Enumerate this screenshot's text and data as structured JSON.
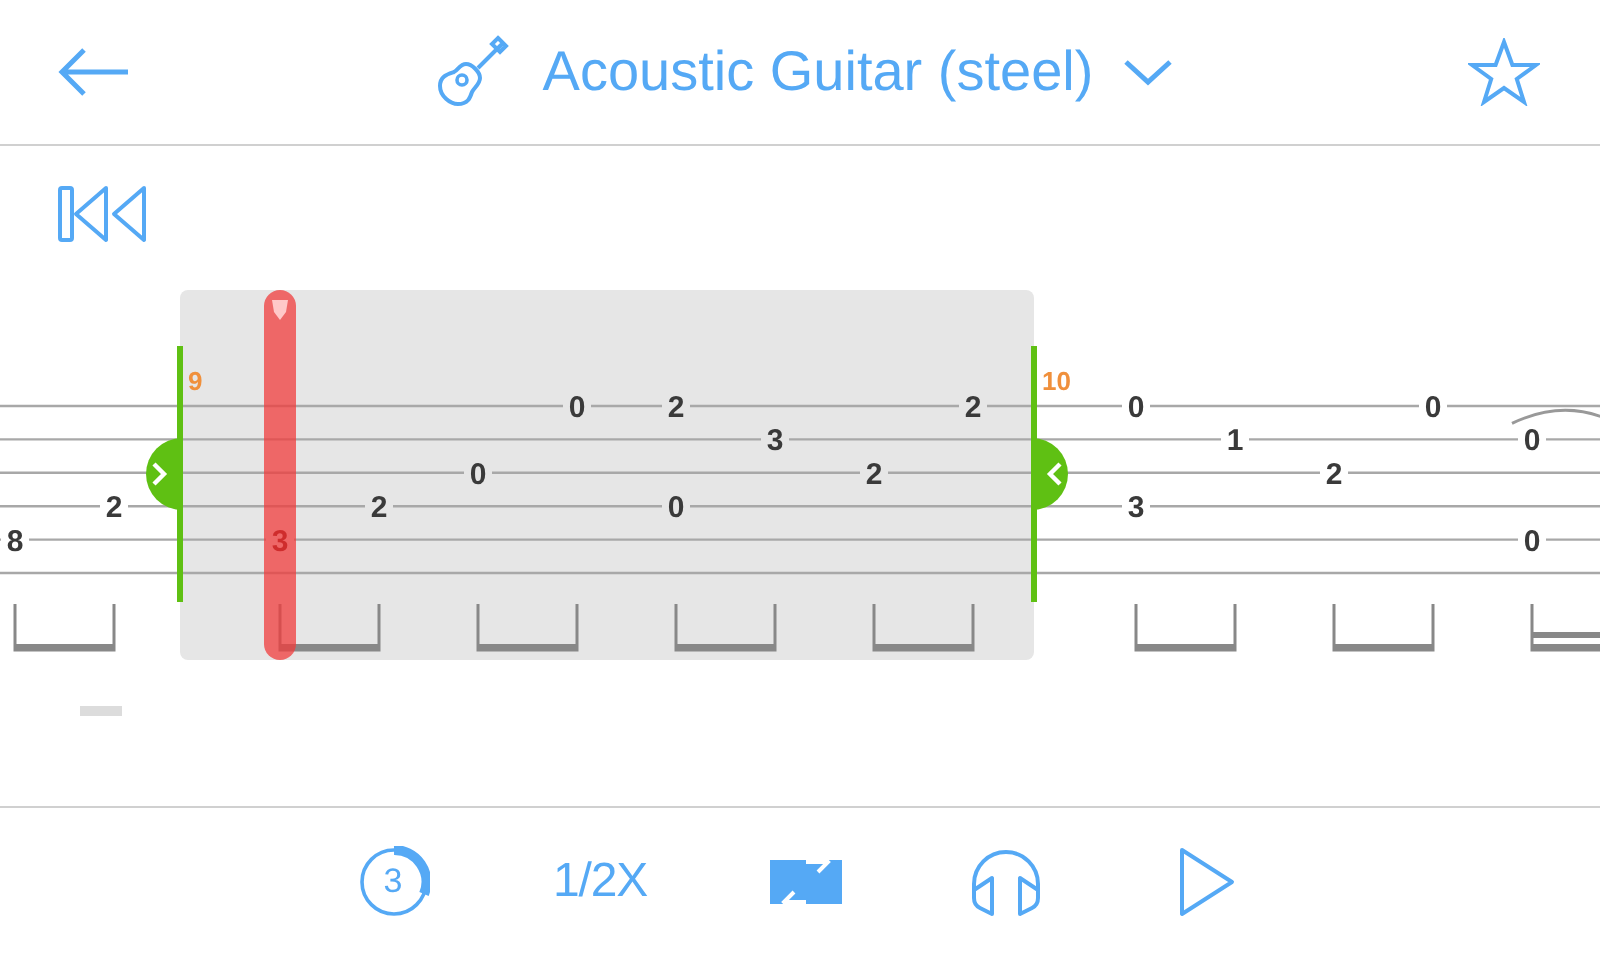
{
  "header": {
    "title": "Acoustic Guitar (steel)"
  },
  "measures": [
    {
      "selected": false,
      "beats": [
        {
          "s5": "8",
          "cursor": false,
          "tie": false
        },
        {
          "s4": "2",
          "cursor": false,
          "tie": false
        }
      ]
    },
    {
      "number": "9",
      "selected": true,
      "beats": [
        {
          "s5": "3",
          "cursor": true,
          "tie": false
        },
        {
          "s4": "2",
          "cursor": false,
          "tie": false
        },
        {
          "s3": "0",
          "cursor": false,
          "tie": false
        },
        {
          "s1": "0",
          "cursor": false,
          "tie": false
        },
        {
          "s1": "2",
          "s4": "0",
          "cursor": false,
          "tie": false
        },
        {
          "s2": "3",
          "cursor": false,
          "tie": false
        },
        {
          "s3": "2",
          "cursor": false,
          "tie": false
        },
        {
          "s1": "2",
          "cursor": false,
          "tie": false
        }
      ]
    },
    {
      "number": "10",
      "selected": false,
      "beats": [
        {
          "s1": "0",
          "s4": "3",
          "cursor": false,
          "tie": false
        },
        {
          "s2": "1",
          "cursor": false,
          "tie": false
        },
        {
          "s3": "2",
          "cursor": false,
          "tie": false
        },
        {
          "s1": "0",
          "cursor": false,
          "tie": false
        },
        {
          "s2": "0",
          "s5": "0",
          "cursor": false,
          "tie": true
        }
      ]
    }
  ],
  "toolbar": {
    "countdown": "3",
    "speed": "1/2X",
    "loop": {
      "on": true
    }
  }
}
